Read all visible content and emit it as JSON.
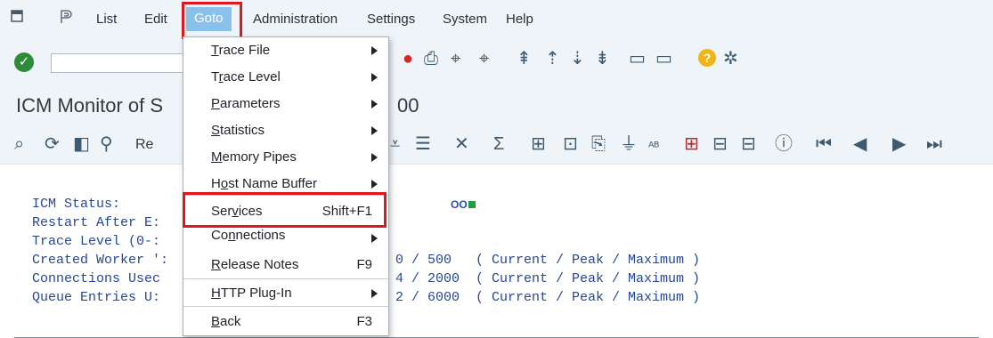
{
  "menubar": {
    "items": [
      {
        "label": "List",
        "mnemonic": "L"
      },
      {
        "label": "Edit",
        "mnemonic": "E"
      },
      {
        "label": "Goto",
        "mnemonic": "G"
      },
      {
        "label": "Administration",
        "mnemonic": "A"
      },
      {
        "label": "Settings",
        "mnemonic": "S"
      },
      {
        "label": "System",
        "mnemonic": "y"
      },
      {
        "label": "Help",
        "mnemonic": "H"
      }
    ]
  },
  "toolbar": {
    "command_field_value": "",
    "icons": [
      "enter-check-icon",
      "cancel-icon",
      "print-icon",
      "find-icon",
      "find-next-icon",
      "first-page-icon",
      "previous-page-icon",
      "next-page-icon",
      "last-page-icon",
      "new-session-icon",
      "shortcut-icon",
      "help-icon",
      "settings-icon"
    ]
  },
  "title": {
    "text_visible_left": "ICM Monitor of S",
    "text_visible_right": "00"
  },
  "apptoolbar": {
    "visible_left_label": "Re",
    "icons": [
      "details-icon",
      "refresh-icon",
      "toggle-icon",
      "binoculars-icon",
      "sort-up-icon",
      "filter-icon",
      "delete-icon",
      "sum-icon",
      "subtotal-icon",
      "display-icon",
      "export-icon",
      "funnel-icon",
      "spelling-icon",
      "table-icon",
      "layout-icon",
      "layout-save-icon",
      "info-icon",
      "first-icon",
      "prev-icon",
      "next-icon",
      "last-icon"
    ]
  },
  "content": {
    "lines": [
      {
        "label": "ICM Status:"
      },
      {
        "label": "Restart After E:"
      },
      {
        "label": "Trace Level (0-:"
      },
      {
        "label": "Created Worker ':",
        "values": "/ 500   ( Current / Peak / Maximum )",
        "lead": "0"
      },
      {
        "label": "Connections Usec",
        "values": "/ 2000  ( Current / Peak / Maximum )",
        "lead": "4"
      },
      {
        "label": "Queue Entries U:",
        "values": "/ 6000  ( Current / Peak / Maximum )",
        "lead": "2"
      }
    ],
    "status_indicator": "OO"
  },
  "dropdown": {
    "items": [
      {
        "label": "Trace File",
        "mnemonic": "T",
        "shortcut": "",
        "submenu": true
      },
      {
        "label": "Trace Level",
        "mnemonic": "r",
        "shortcut": "",
        "submenu": true
      },
      {
        "label": "Parameters",
        "mnemonic": "P",
        "shortcut": "",
        "submenu": true
      },
      {
        "label": "Statistics",
        "mnemonic": "S",
        "shortcut": "",
        "submenu": true
      },
      {
        "label": "Memory Pipes",
        "mnemonic": "M",
        "shortcut": "",
        "submenu": true
      },
      {
        "label": "Host Name Buffer",
        "mnemonic": "o",
        "shortcut": "",
        "submenu": true
      },
      {
        "label": "Services",
        "mnemonic": "v",
        "shortcut": "Shift+F1",
        "submenu": false
      },
      {
        "label": "Connections",
        "mnemonic": "n",
        "shortcut": "",
        "submenu": true
      },
      {
        "label": "Release Notes",
        "mnemonic": "R",
        "shortcut": "F9",
        "submenu": false
      },
      {
        "label": "HTTP Plug-In",
        "mnemonic": "H",
        "shortcut": "",
        "submenu": true
      },
      {
        "label": "Back",
        "mnemonic": "B",
        "shortcut": "F3",
        "submenu": false
      }
    ]
  },
  "colors": {
    "accent": "#8ac1ea",
    "highlight": "#e0181e",
    "mono_text": "#27479a",
    "bar_bg": "#eff4f9"
  }
}
